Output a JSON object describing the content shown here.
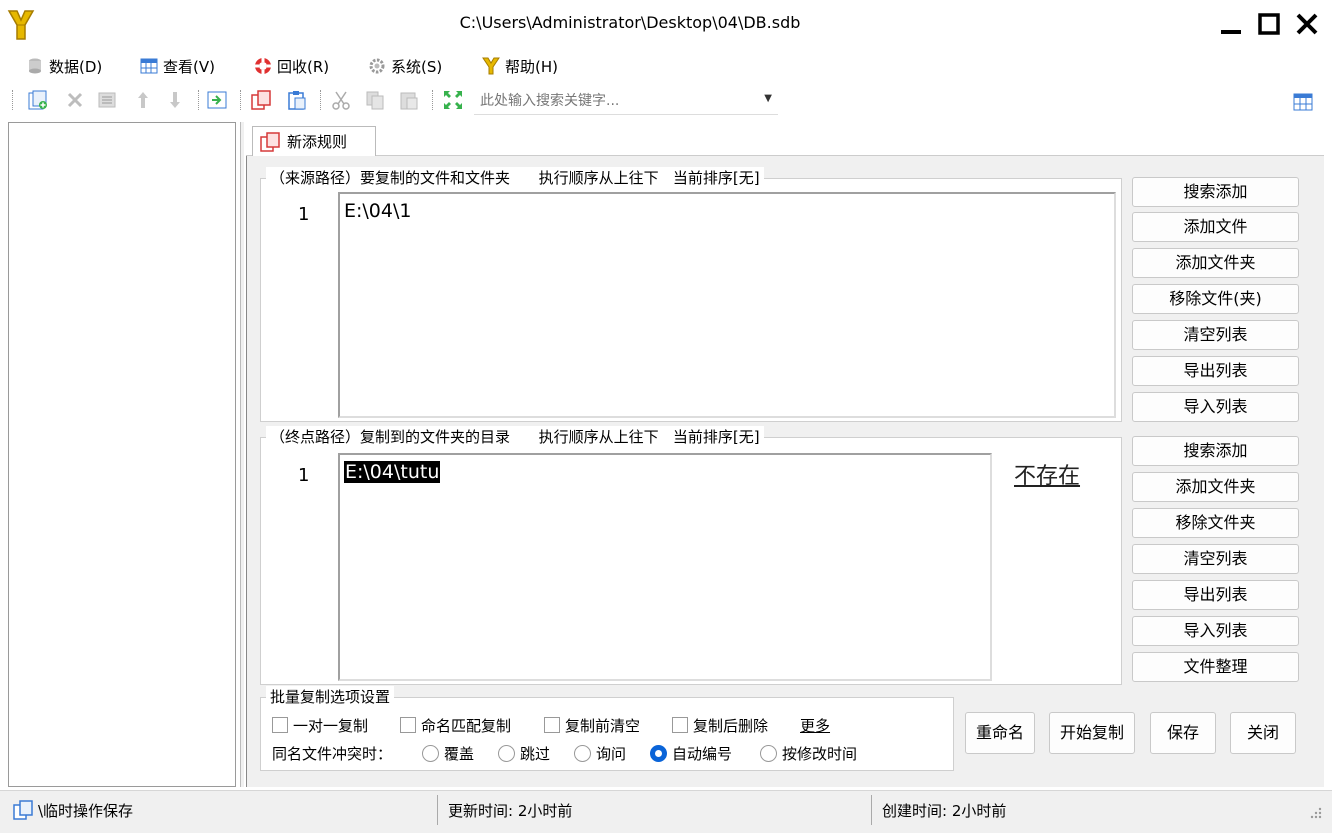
{
  "window": {
    "title": "C:\\Users\\Administrator\\Desktop\\04\\DB.sdb",
    "minimize": "—",
    "maximize": "☐",
    "close": "✕"
  },
  "menu": [
    {
      "label": "数据(D)",
      "icon": "database-icon"
    },
    {
      "label": "查看(V)",
      "icon": "view-grid-icon"
    },
    {
      "label": "回收(R)",
      "icon": "lifebuoy-icon"
    },
    {
      "label": "系统(S)",
      "icon": "gear-icon"
    },
    {
      "label": "帮助(H)",
      "icon": "help-logo-icon"
    }
  ],
  "toolbar": {
    "search_placeholder": "此处输入搜索关键字...",
    "dropdown_glyph": "▼"
  },
  "tab": {
    "label": "新添规则"
  },
  "source": {
    "legend": "（来源路径）要复制的文件和文件夹      执行顺序从上往下   当前排序[无]",
    "items": [
      {
        "num": "1",
        "path": "E:\\04\\1"
      }
    ],
    "buttons": [
      "搜索添加",
      "添加文件",
      "添加文件夹",
      "移除文件(夹)",
      "清空列表",
      "导出列表",
      "导入列表"
    ]
  },
  "dest": {
    "legend": "（终点路径）复制到的文件夹的目录      执行顺序从上往下   当前排序[无]",
    "items": [
      {
        "num": "1",
        "path": "E:\\04\\tutu"
      }
    ],
    "status": "不存在",
    "buttons": [
      "搜索添加",
      "添加文件夹",
      "移除文件夹",
      "清空列表",
      "导出列表",
      "导入列表",
      "文件整理"
    ]
  },
  "options": {
    "legend": "批量复制选项设置",
    "checkboxes": [
      "一对一复制",
      "命名匹配复制",
      "复制前清空",
      "复制后删除"
    ],
    "more": "更多",
    "conflict_label": "同名文件冲突时：",
    "radios": [
      "覆盖",
      "跳过",
      "询问",
      "自动编号",
      "按修改时间"
    ],
    "selected_radio": "自动编号"
  },
  "actions": {
    "rename": "重命名",
    "start": "开始复制",
    "save": "保存",
    "close": "关闭"
  },
  "status": {
    "left": "\\临时操作保存",
    "updated": "更新时间: 2小时前",
    "created": "创建时间: 2小时前"
  }
}
